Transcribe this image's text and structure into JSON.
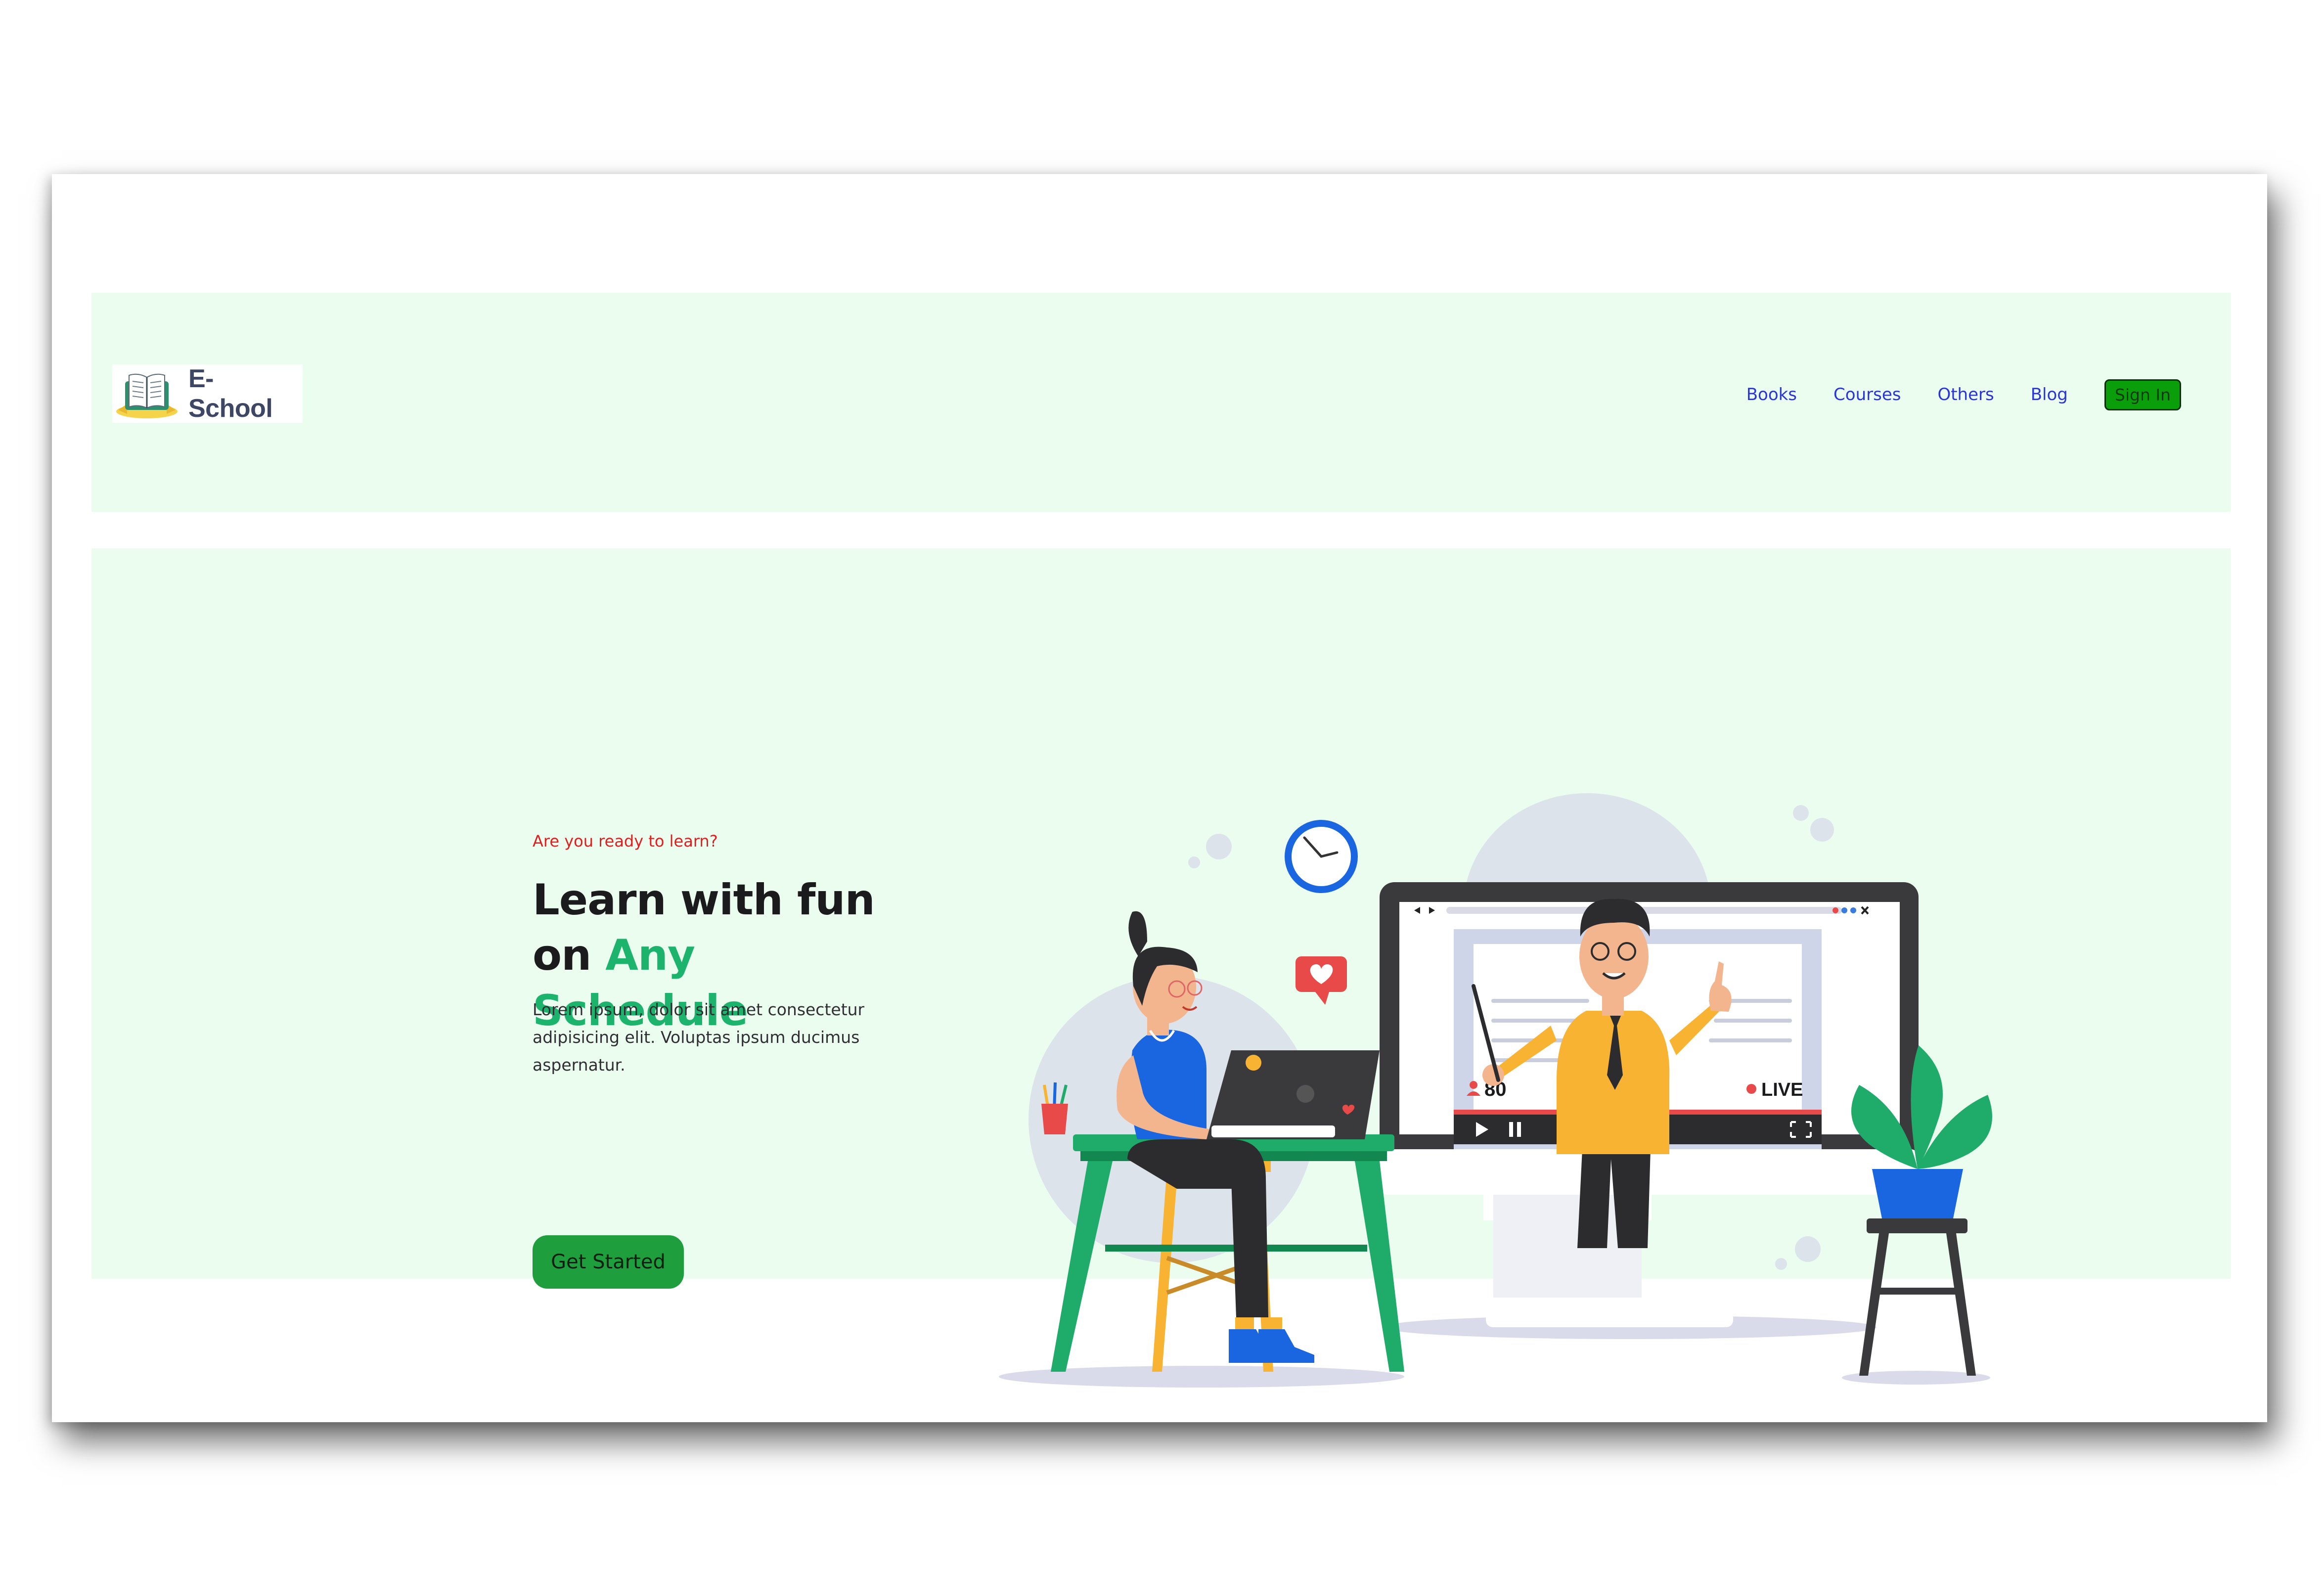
{
  "brand": {
    "logo_text": "E- School"
  },
  "nav": {
    "items": [
      {
        "label": "Books"
      },
      {
        "label": "Courses"
      },
      {
        "label": "Others"
      },
      {
        "label": "Blog"
      }
    ],
    "signin_label": "Sign In"
  },
  "hero": {
    "tagline": "Are you ready to learn?",
    "headline_line1": "Learn with fun",
    "headline_on": "on",
    "headline_accent": "Any Schedule",
    "description": "Lorem ipsum, dolor sit amet consectetur adipisicing elit. Voluptas ipsum ducimus aspernatur.",
    "cta_label": "Get Started"
  },
  "illustration": {
    "viewer_count": "80",
    "live_label": "LIVE"
  },
  "colors": {
    "section_bg": "#ebfdef",
    "accent_green": "#1cb46c",
    "tagline_red": "#e02020",
    "nav_link": "#2a35d6",
    "cta_green": "#1f9e3d",
    "signin_green": "#0a9f0a"
  }
}
